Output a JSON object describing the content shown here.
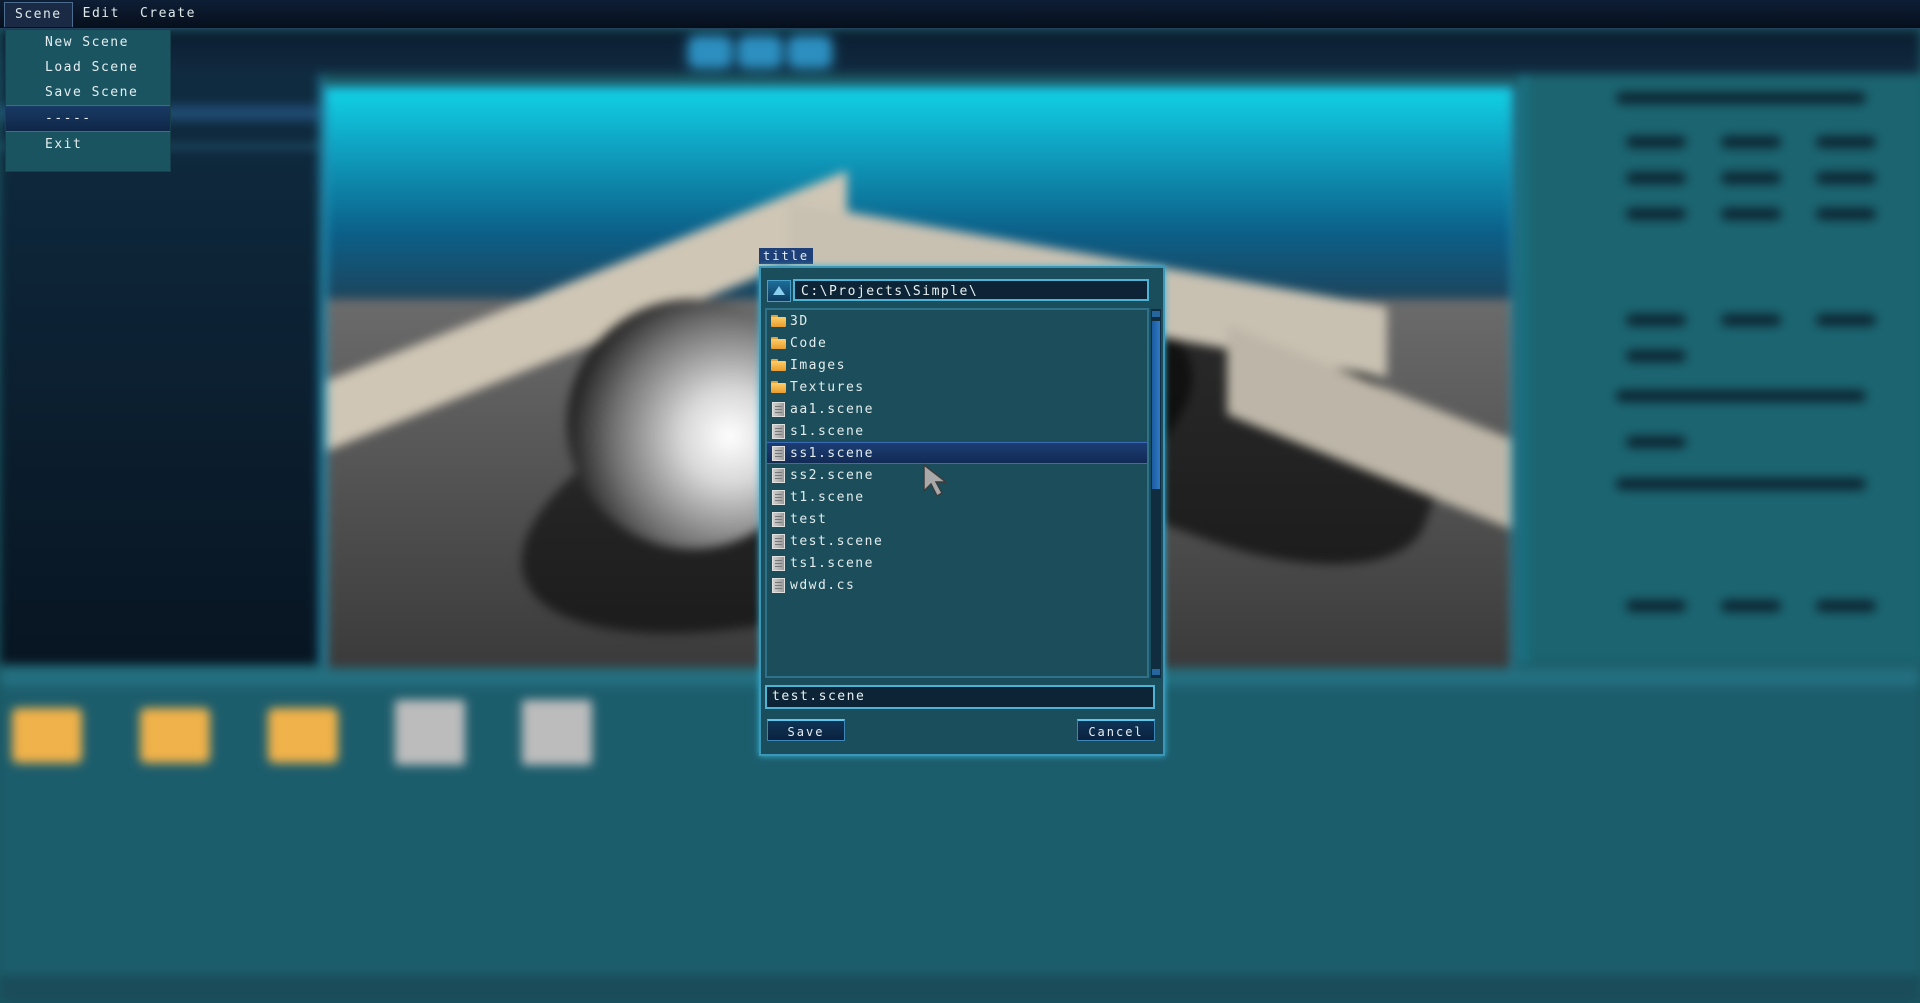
{
  "menubar": {
    "items": [
      {
        "label": "Scene"
      },
      {
        "label": "Edit"
      },
      {
        "label": "Create"
      }
    ]
  },
  "scene_menu": {
    "items": [
      {
        "label": "New Scene"
      },
      {
        "label": "Load Scene"
      },
      {
        "label": "Save Scene"
      },
      {
        "label": "-----"
      },
      {
        "label": "Exit"
      }
    ]
  },
  "dialog": {
    "title": "title",
    "path": "C:\\Projects\\Simple\\",
    "files": [
      {
        "name": "3D",
        "type": "folder"
      },
      {
        "name": "Code",
        "type": "folder"
      },
      {
        "name": "Images",
        "type": "folder"
      },
      {
        "name": "Textures",
        "type": "folder"
      },
      {
        "name": "aa1.scene",
        "type": "file"
      },
      {
        "name": "s1.scene",
        "type": "file"
      },
      {
        "name": "ss1.scene",
        "type": "file",
        "selected": true
      },
      {
        "name": "ss2.scene",
        "type": "file"
      },
      {
        "name": "t1.scene",
        "type": "file"
      },
      {
        "name": "test",
        "type": "file"
      },
      {
        "name": "test.scene",
        "type": "file"
      },
      {
        "name": "ts1.scene",
        "type": "file"
      },
      {
        "name": "wdwd.cs",
        "type": "file"
      }
    ],
    "filename": "test.scene",
    "save_label": "Save",
    "cancel_label": "Cancel"
  },
  "colors": {
    "accent": "#3b96b8",
    "selection": "#1c3d74",
    "panel": "#1a4e5c"
  }
}
